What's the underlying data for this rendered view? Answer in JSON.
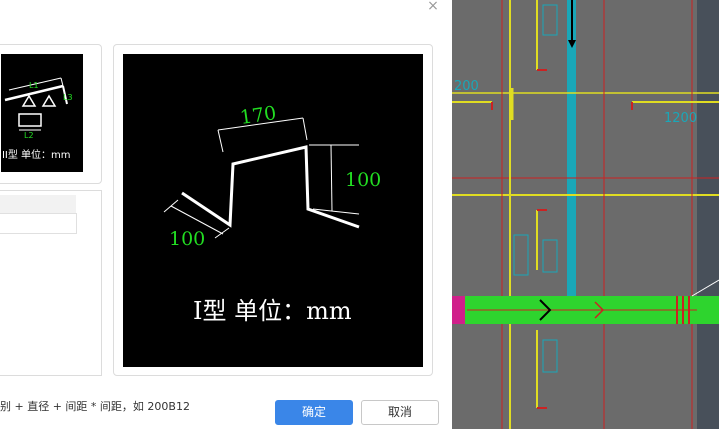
{
  "dialog": {
    "close_glyph": "×",
    "type3_card": {
      "caption": "III型 单位：mm",
      "l1": "L1",
      "l2": "L2",
      "l3": "L3"
    },
    "type1_card": {
      "caption": "I型 单位：mm",
      "dim_top": "170",
      "dim_right": "100",
      "dim_left": "100"
    },
    "hint": "别 + 直径 + 间距 * 间距，如 200B12",
    "ok_label": "确定",
    "cancel_label": "取消"
  },
  "cad": {
    "labels": [
      "200",
      "1200"
    ]
  },
  "colors": {
    "primary": "#3a86e8",
    "cad_bg": "#6b6b6b",
    "dim_green": "#22dd22"
  }
}
